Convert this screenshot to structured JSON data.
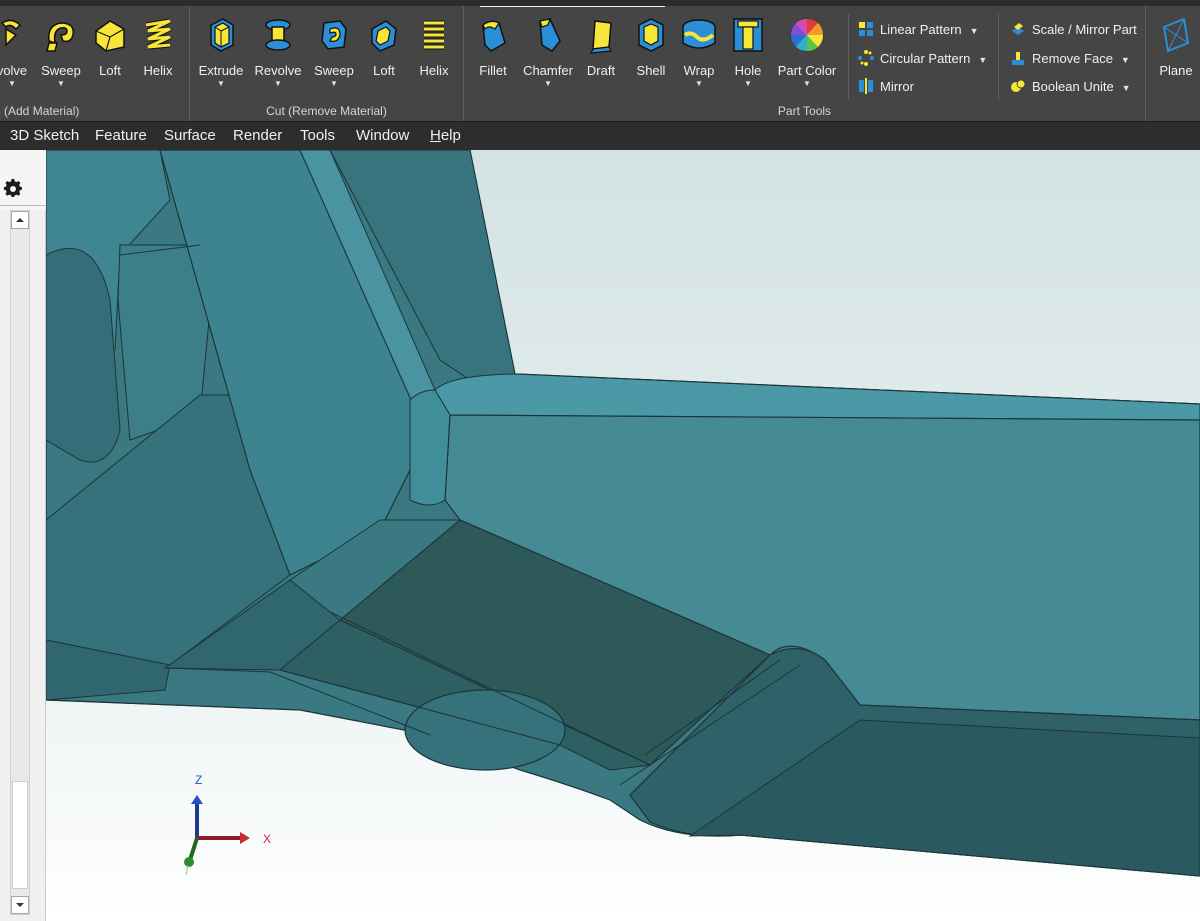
{
  "ribbon": {
    "boss_group": {
      "label": "Boss (Add Material)",
      "tools": [
        {
          "label": "volve",
          "icon": "revolve-icon",
          "caret": true
        },
        {
          "label": "Sweep",
          "icon": "sweep-icon",
          "caret": true
        },
        {
          "label": "Loft",
          "icon": "loft-icon",
          "caret": false
        },
        {
          "label": "Helix",
          "icon": "helix-icon",
          "caret": false
        }
      ]
    },
    "cut_group": {
      "label": "Cut (Remove Material)",
      "tools": [
        {
          "label": "Extrude",
          "icon": "extrude-cut-icon",
          "caret": true
        },
        {
          "label": "Revolve",
          "icon": "revolve-cut-icon",
          "caret": true
        },
        {
          "label": "Sweep",
          "icon": "sweep-cut-icon",
          "caret": true
        },
        {
          "label": "Loft",
          "icon": "loft-cut-icon",
          "caret": false
        },
        {
          "label": "Helix",
          "icon": "helix-cut-icon",
          "caret": false
        }
      ]
    },
    "part_tools_group": {
      "label": "Part Tools",
      "tools": [
        {
          "label": "Fillet",
          "icon": "fillet-icon",
          "caret": false
        },
        {
          "label": "Chamfer",
          "icon": "chamfer-icon",
          "caret": true
        },
        {
          "label": "Draft",
          "icon": "draft-icon",
          "caret": false
        },
        {
          "label": "Shell",
          "icon": "shell-icon",
          "caret": false
        },
        {
          "label": "Wrap",
          "icon": "wrap-icon",
          "caret": true
        },
        {
          "label": "Hole",
          "icon": "hole-icon",
          "caret": true
        },
        {
          "label": "Part Color",
          "icon": "part-color-icon",
          "caret": true
        }
      ],
      "small_tools": [
        {
          "label": "Linear Pattern",
          "icon": "linear-pattern-icon",
          "caret": true
        },
        {
          "label": "Circular Pattern",
          "icon": "circular-pattern-icon",
          "caret": true
        },
        {
          "label": "Mirror",
          "icon": "mirror-icon",
          "caret": false
        },
        {
          "label": "Scale / Mirror Part",
          "icon": "scale-mirror-part-icon",
          "caret": false
        },
        {
          "label": "Remove Face",
          "icon": "remove-face-icon",
          "caret": true
        },
        {
          "label": "Boolean Unite",
          "icon": "boolean-unite-icon",
          "caret": true
        }
      ]
    },
    "plane_tool": {
      "label": "Plane",
      "icon": "plane-icon"
    }
  },
  "menubar": {
    "items": [
      "3D Sketch",
      "Feature",
      "Surface",
      "Render",
      "Tools",
      "Window",
      "Help"
    ]
  },
  "viewport": {
    "axes": {
      "x": "X",
      "z": "Z"
    }
  },
  "colors": {
    "ribbon_bg": "#454545",
    "icon_yellow": "#f7e53a",
    "icon_blue": "#2a8fd6",
    "model_teal": "#3d7f89",
    "background_top": "#d3e2e2",
    "background_bottom": "#ffffff"
  }
}
